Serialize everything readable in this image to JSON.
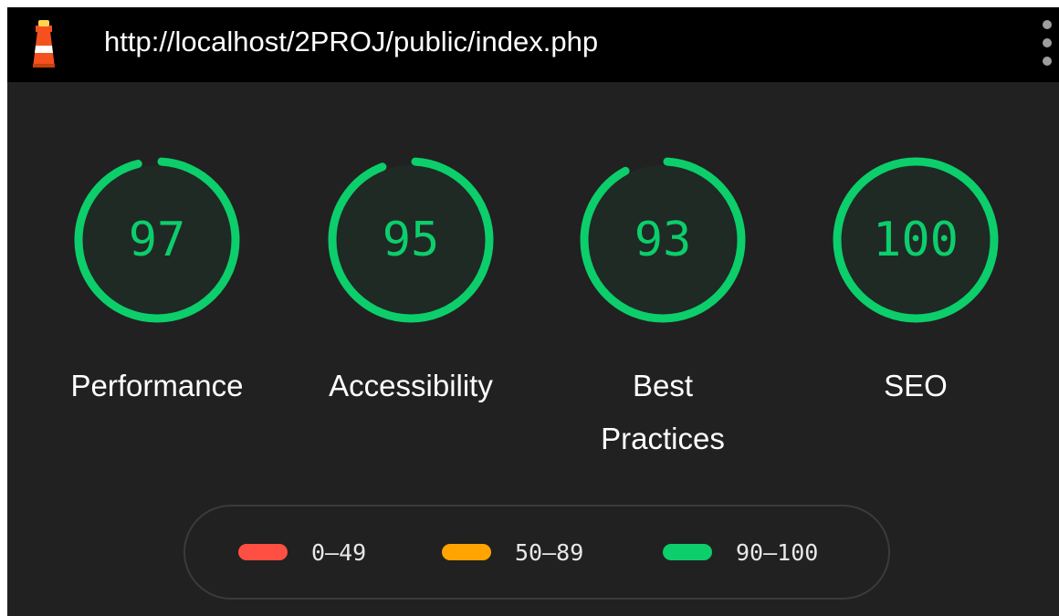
{
  "header": {
    "url": "http://localhost/2PROJ/public/index.php",
    "logo_icon": "lighthouse-icon",
    "menu_icon": "more-vertical-icon"
  },
  "gauges": [
    {
      "label": "Performance",
      "score": 97
    },
    {
      "label": "Accessibility",
      "score": 95
    },
    {
      "label": "Best Practices",
      "score": 93
    },
    {
      "label": "SEO",
      "score": 100
    }
  ],
  "legend": [
    {
      "range": "0–49",
      "color": "#ff4e42"
    },
    {
      "range": "50–89",
      "color": "#ffa400"
    },
    {
      "range": "90–100",
      "color": "#0cce6b"
    }
  ],
  "colors": {
    "pass": "#0cce6b",
    "gauge_fill": "#1f2a25",
    "background": "#212121",
    "topbar": "#000000"
  }
}
